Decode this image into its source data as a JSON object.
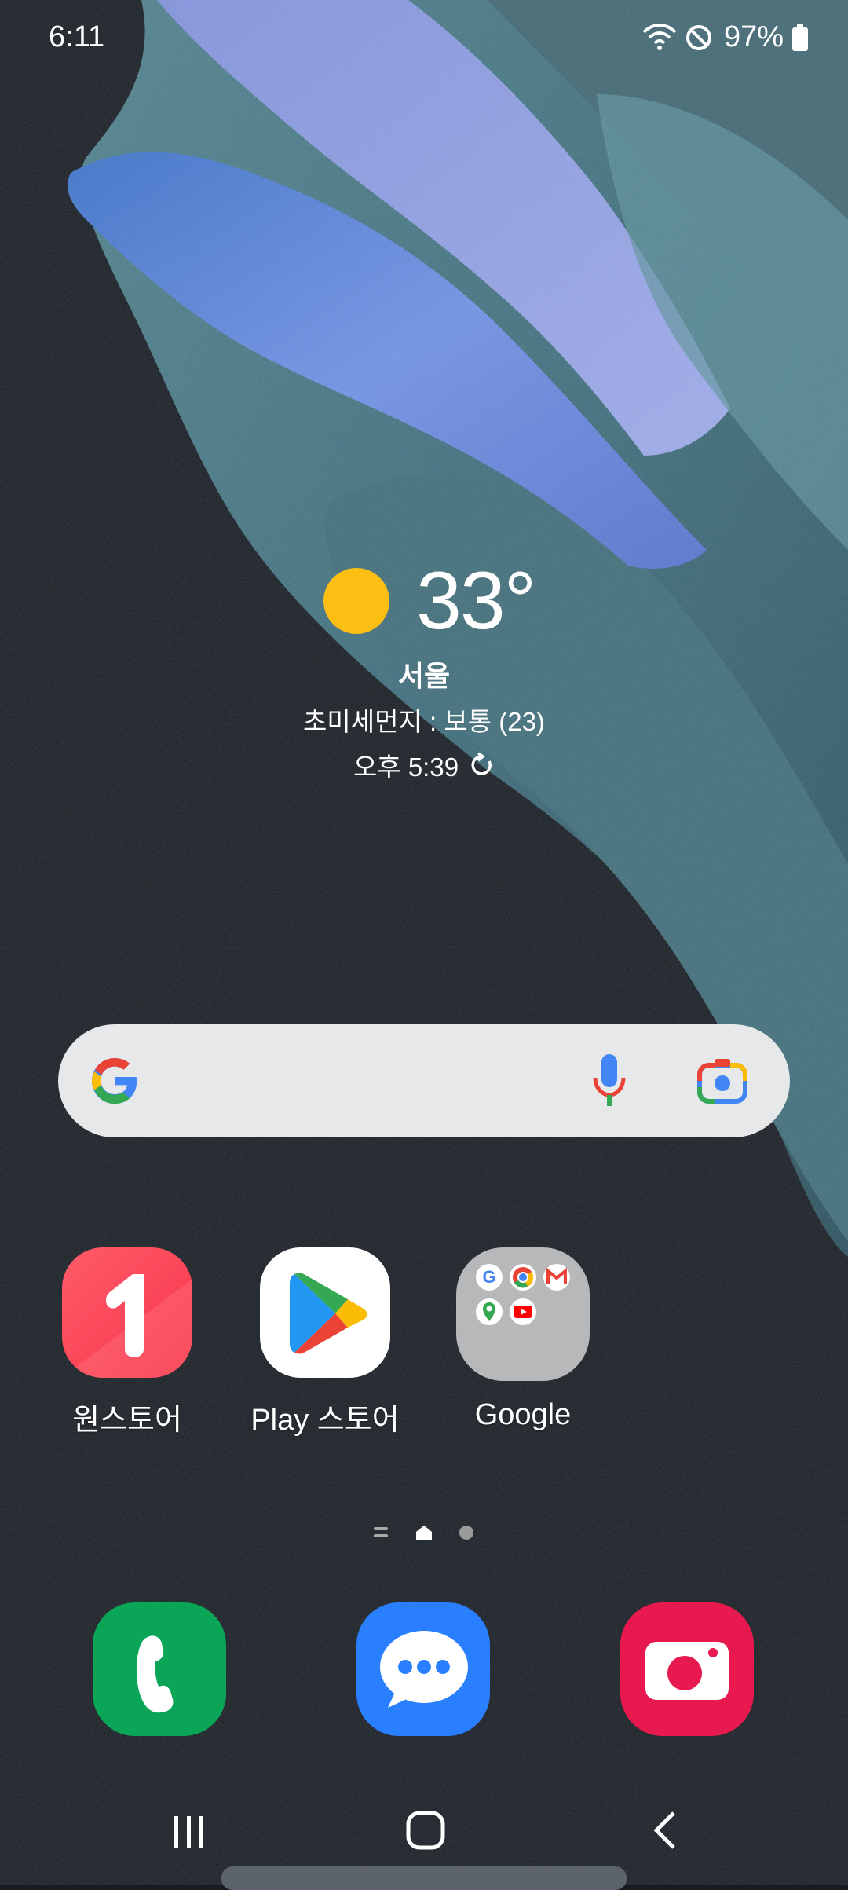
{
  "status_bar": {
    "time": "6:11",
    "battery_percent": "97%",
    "icons": [
      "wifi-icon",
      "do-not-disturb-icon",
      "battery-icon"
    ]
  },
  "weather": {
    "temperature": "33°",
    "city": "서울",
    "air_quality": "초미세먼지 : 보통 (23)",
    "updated_time": "오후 5:39",
    "icons": [
      "sun-icon",
      "refresh-icon"
    ],
    "sun_color": "#fbbf14"
  },
  "search_bar": {
    "icons": [
      "google-logo-icon",
      "microphone-icon",
      "google-lens-icon"
    ]
  },
  "apps": [
    {
      "label": "원스토어",
      "icon": "onestore-icon",
      "color": "#ff4050"
    },
    {
      "label": "Play 스토어",
      "icon": "play-store-icon",
      "color": "#ffffff"
    },
    {
      "label": "Google",
      "icon": "google-folder-icon",
      "color": "#b8b9bb"
    }
  ],
  "folder_apps": [
    "google-icon",
    "chrome-icon",
    "gmail-icon",
    "maps-icon",
    "youtube-icon"
  ],
  "page_indicator": {
    "pages": [
      "list-icon",
      "home-icon",
      "dot-icon"
    ],
    "current": 1
  },
  "dock": [
    {
      "icon": "phone-icon",
      "color": "#0aa557"
    },
    {
      "icon": "messages-icon",
      "color": "#2a7fff"
    },
    {
      "icon": "camera-icon",
      "color": "#e8194e"
    }
  ],
  "nav_bar": {
    "buttons": [
      "recents-icon",
      "home-button-icon",
      "back-icon"
    ]
  }
}
